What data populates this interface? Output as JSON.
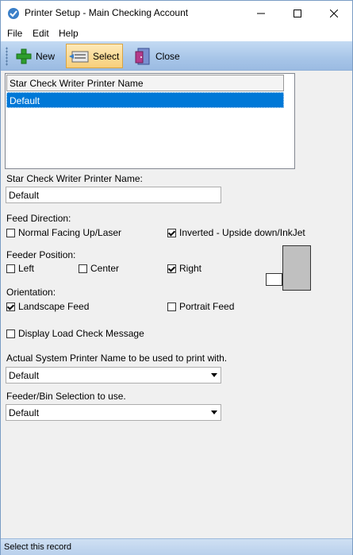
{
  "window": {
    "title": "Printer Setup - Main Checking Account"
  },
  "menu": {
    "file_label": "File",
    "edit_label": "Edit",
    "help_label": "Help"
  },
  "toolbar": {
    "new_label": "New",
    "select_label": "Select",
    "close_label": "Close"
  },
  "list": {
    "header": "Star Check Writer Printer Name",
    "rows": [
      "Default"
    ]
  },
  "form": {
    "printer_name_label": "Star Check Writer Printer Name:",
    "printer_name_value": "Default",
    "feed_direction_label": "Feed Direction:",
    "feed_normal_label": "Normal Facing Up/Laser",
    "feed_normal_checked": false,
    "feed_inverted_label": "Inverted - Upside down/InkJet",
    "feed_inverted_checked": true,
    "feeder_position_label": "Feeder Position:",
    "pos_left_label": "Left",
    "pos_left_checked": false,
    "pos_center_label": "Center",
    "pos_center_checked": false,
    "pos_right_label": "Right",
    "pos_right_checked": true,
    "orientation_label": "Orientation:",
    "landscape_label": "Landscape Feed",
    "landscape_checked": true,
    "portrait_label": "Portrait Feed",
    "portrait_checked": false,
    "display_load_label": "Display Load Check Message",
    "display_load_checked": false,
    "system_printer_label": "Actual System Printer Name to be used to print with.",
    "system_printer_value": "Default",
    "bin_label": "Feeder/Bin Selection to use.",
    "bin_value": "Default"
  },
  "status": {
    "text": "Select this record"
  },
  "colors": {
    "selection": "#0078d7",
    "toolbar": "#a7c5e8",
    "active_button": "#f8cf7a"
  }
}
